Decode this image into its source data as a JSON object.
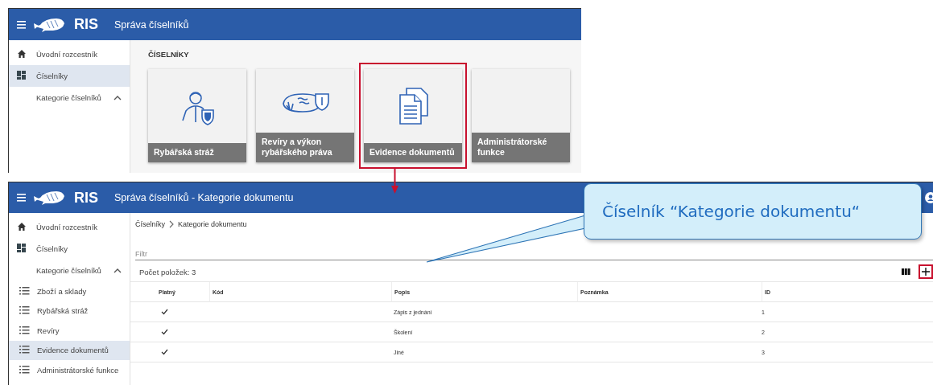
{
  "screens": [
    {
      "kind": "tiles",
      "header": {
        "logo": "RIS",
        "title": "Správa číselníků"
      },
      "sidebar": [
        {
          "kind": "home",
          "label": "Úvodní rozcestník",
          "selected": false
        },
        {
          "kind": "dashboard",
          "label": "Číselníky",
          "selected": true
        },
        {
          "kind": "group",
          "label": "Kategorie číselníků",
          "selected": false,
          "expanded": true
        }
      ],
      "section_title": "ČÍSELNÍKY",
      "tiles": [
        {
          "kind": "guard",
          "label": "Rybářská stráž",
          "highlighted": false
        },
        {
          "kind": "waters",
          "label": "Revíry a výkon rybářského práva",
          "highlighted": false
        },
        {
          "kind": "documents",
          "label": "Evidence dokumentů",
          "highlighted": true
        },
        {
          "kind": "blank",
          "label": "Administrátorské funkce",
          "highlighted": false
        }
      ]
    },
    {
      "kind": "table",
      "header": {
        "logo": "RIS",
        "title": "Správa číselníků - Kategorie dokumentu"
      },
      "sidebar": [
        {
          "kind": "home",
          "label": "Úvodní rozcestník",
          "selected": false
        },
        {
          "kind": "dashboard",
          "label": "Číselníky",
          "selected": false
        },
        {
          "kind": "group",
          "label": "Kategorie číselníků",
          "selected": false,
          "expanded": true,
          "children": [
            {
              "kind": "list",
              "label": "Zboží a sklady",
              "selected": false
            },
            {
              "kind": "list",
              "label": "Rybářská stráž",
              "selected": false
            },
            {
              "kind": "list",
              "label": "Revíry",
              "selected": false
            },
            {
              "kind": "list",
              "label": "Evidence dokumentů",
              "selected": true
            },
            {
              "kind": "list",
              "label": "Administrátorské funkce",
              "selected": false
            }
          ]
        }
      ],
      "breadcrumb": [
        "Číselníky",
        "Kategorie dokumentu"
      ],
      "filter": {
        "placeholder": "Filtr"
      },
      "count": "Počet položek: 3",
      "add_button": {
        "highlighted": true
      },
      "table": {
        "columns": [
          "Platný",
          "Kód",
          "Popis",
          "Poznámka",
          "ID"
        ],
        "rows": [
          {
            "valid": true,
            "description": "Zápis z jednání",
            "id": "1"
          },
          {
            "valid": true,
            "description": "Školení",
            "id": "2"
          },
          {
            "valid": true,
            "description": "Jiné",
            "id": "3"
          }
        ]
      }
    }
  ],
  "callout": {
    "text": "Číselník “Kategorie dokumentu“"
  }
}
